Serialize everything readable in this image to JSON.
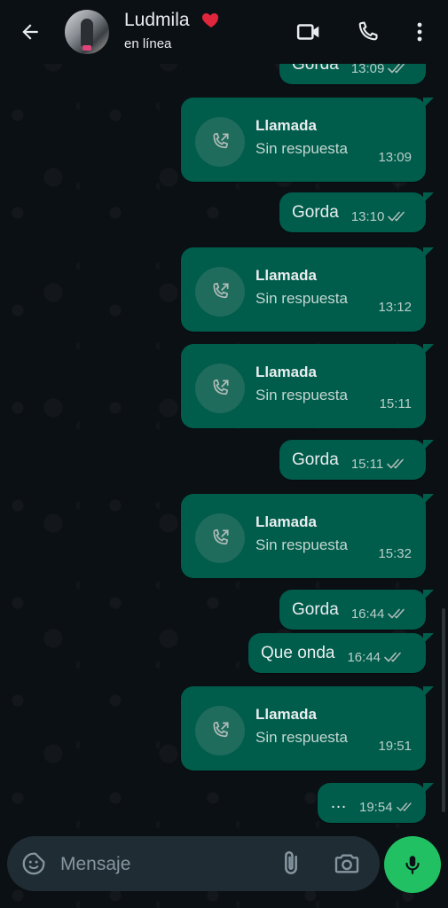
{
  "header": {
    "contact_name": "Ludmila",
    "status": "en línea",
    "icons": [
      "back-arrow-icon",
      "video-call-icon",
      "voice-call-icon",
      "more-vert-icon",
      "heart-icon"
    ]
  },
  "messages": [
    {
      "type": "text",
      "text": "Gorda",
      "time": "13:09",
      "ticks": "read"
    },
    {
      "type": "call",
      "title": "Llamada",
      "subtitle": "Sin respuesta",
      "time": "13:09"
    },
    {
      "type": "text",
      "text": "Gorda",
      "time": "13:10",
      "ticks": "read"
    },
    {
      "type": "call",
      "title": "Llamada",
      "subtitle": "Sin respuesta",
      "time": "13:12"
    },
    {
      "type": "call",
      "title": "Llamada",
      "subtitle": "Sin respuesta",
      "time": "15:11"
    },
    {
      "type": "text",
      "text": "Gorda",
      "time": "15:11",
      "ticks": "read"
    },
    {
      "type": "call",
      "title": "Llamada",
      "subtitle": "Sin respuesta",
      "time": "15:32"
    },
    {
      "type": "text",
      "text": "Gorda",
      "time": "16:44",
      "ticks": "read"
    },
    {
      "type": "text",
      "text": "Que onda",
      "time": "16:44",
      "ticks": "read"
    },
    {
      "type": "call",
      "title": "Llamada",
      "subtitle": "Sin respuesta",
      "time": "19:51"
    },
    {
      "type": "text",
      "text": "…",
      "time": "19:54",
      "ticks": "read"
    }
  ],
  "input": {
    "placeholder": "Mensaje",
    "value": ""
  },
  "colors": {
    "bubble_out": "#005c4b",
    "background": "#0b1014",
    "input_bar": "#1f2c34",
    "mic_button": "#21c063",
    "accent_text": "#e9edef"
  }
}
